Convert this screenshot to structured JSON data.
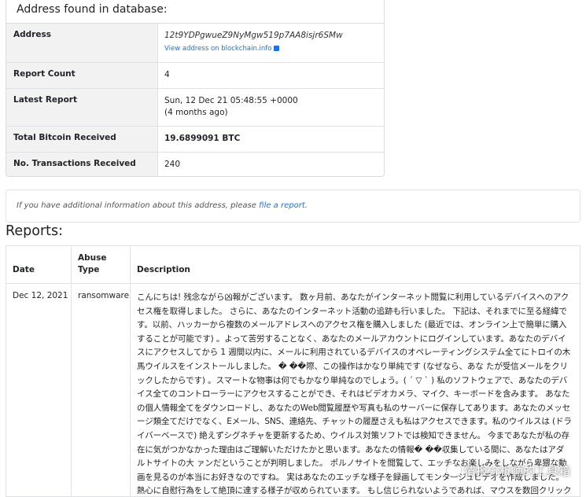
{
  "card": {
    "header": "Address found in database:",
    "rows": [
      {
        "key": "Address",
        "value": "12t9YDPgwueZ9NyMgw519p7AA8isjr6SMw",
        "link": "View address on blockchain.info"
      },
      {
        "key": "Report Count",
        "value": "4"
      },
      {
        "key": "Latest Report",
        "value": "Sun, 12 Dec 21 05:48:55 +0000",
        "value2": "(4 months ago)"
      },
      {
        "key": "Total Bitcoin Received",
        "value": "19.6899091 BTC"
      },
      {
        "key": "No. Transactions Received",
        "value": "240"
      }
    ]
  },
  "info": {
    "text": "If you have additional information about this address, please",
    "link": "file a report",
    "end": "."
  },
  "reports": {
    "heading": "Reports:",
    "columns": [
      "Date",
      "Abuse Type",
      "Description"
    ],
    "row": {
      "date": "Dec 12, 2021",
      "type": "ransomware",
      "description": "こんにちは! 残念ながら凶報がございます。 数ヶ月前、あなたがインターネット閲覧に利用しているデバイスへのアクセス権を取得しました。 さらに、あなたのインターネット活動の追跡も行いました。 下記は、それまでに至る経緯です。以前、ハッカーから複数のメールアドレスへのアクセス権を購入しました (最近では、オンライン上で簡単に購入することが可能です) 。よって苦労することなく、あなたのメールアカウントにログインしています。あなたのデバイスにアクセスしてから 1 週間以内に、メールに利用されているデバイスのオペレーティングシステム全てにトロイの木馬ウイルスをインストールしました。 � ��際、この操作はかなり単純です (なぜなら、あな たが受信メールをクリックしたからです) 。スマートな物事は何でもかなり単純なのでしょう。( ´ ▽ ` ) 私のソフトウェアで、あなたのデバイス全てのコントローラーにアクセスすることができ、それはビデオカメラ、マイク、キーボードを含みます。 あなたの個人情報全てをダウンロードし、あなたのWeb閲覧履歴や写真も私のサーバーに保存してあります。あなたのメッセージ類全てだけでなく、Eメール、SNS、連絡先、チャットの履歴さえも私はアクセスできます。私のウイルスは (ドライバーベースで) 絶えずシグネチャを更新するため、ウイルス対策ソフトでは検知できません。 今まであなたが私の存在に気がつかなかった理由はご理解いただけたかと思います。あなたの情報� ��収集している間に、あなたはアダルトサイトの大 ァンだということが判明しました。 ポルノサイトを閲覧して、エッチなお楽しみをしながら卑猥な動画を見るのが本当にお好きなのですね。 実はあなたのエッチな様子を録画してモンタージュビデオを作成しました。熱心に自慰行為をして絶頂に達する様子が収められています。 もし信じられないようであれば、マウスを数回クリックするだけでそのビデオをあなたの友人、親戚や同僚の方々と共有する"
    }
  },
  "watermark": "情报分析师的工具箱"
}
